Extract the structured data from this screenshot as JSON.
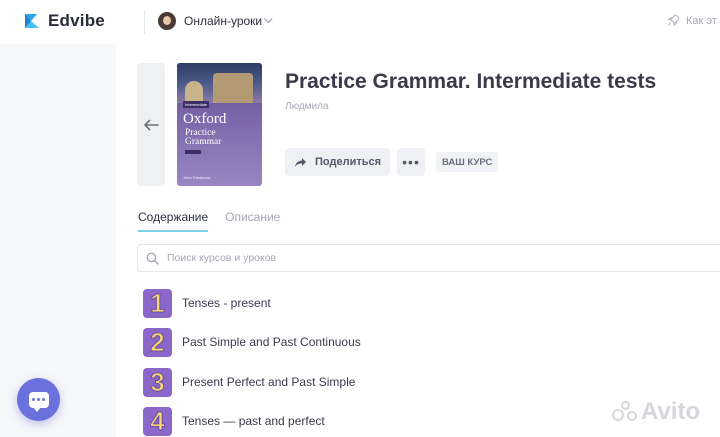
{
  "brand": {
    "name": "Edvibe"
  },
  "school": {
    "name": "Онлайн-уроки"
  },
  "topbar": {
    "how_label": "Как эт"
  },
  "course": {
    "title": "Practice Grammar. Intermediate tests",
    "author": "Людмила",
    "share_label": "Поделиться",
    "more_label": "•••",
    "your_course_label": "ВАШ КУРС",
    "cover": {
      "badge": "Intermediate",
      "title_line1": "Oxford",
      "title_line2": "Practice",
      "title_line3": "Grammar",
      "footer": "John Eastwood"
    }
  },
  "tabs": [
    {
      "label": "Содержание",
      "active": true
    },
    {
      "label": "Описание",
      "active": false
    }
  ],
  "search": {
    "placeholder": "Поиск курсов и уроков",
    "value": ""
  },
  "lessons": [
    {
      "number": "1",
      "title": "Tenses - present"
    },
    {
      "number": "2",
      "title": "Past Simple and Past Continuous"
    },
    {
      "number": "3",
      "title": "Present Perfect and Past Simple"
    },
    {
      "number": "4",
      "title": "Tenses — past and perfect"
    }
  ],
  "watermark": {
    "text": "Avito"
  },
  "colors": {
    "accent": "#6a71dc",
    "tab_underline": "#7dd3e3",
    "lesson_badge": "#8a67c8",
    "lesson_number": "#f8d86e"
  }
}
